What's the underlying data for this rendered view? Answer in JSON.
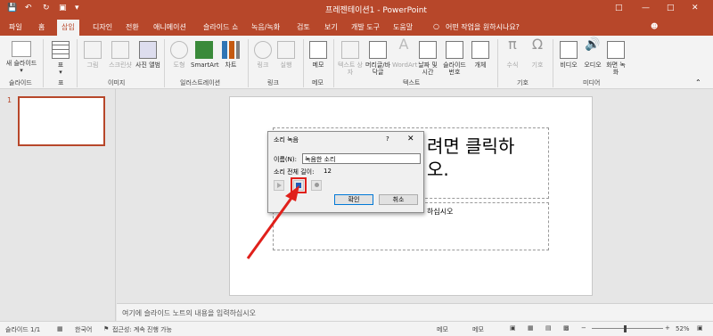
{
  "window": {
    "title": "프레젠테이션1 - PowerPoint",
    "file_tab": "파일",
    "tabs": [
      "홈",
      "삽입",
      "디자인",
      "전환",
      "애니메이션",
      "슬라이드 쇼",
      "녹음/녹화",
      "검토",
      "보기",
      "개발 도구",
      "도움말"
    ],
    "tell_me": "어떤 작업을 원하시나요?"
  },
  "ribbon": {
    "new_slide": "새 슬라이드",
    "table": "표",
    "picture": "그림",
    "screenshot": "스크린샷",
    "photo_album": "사진 앨범",
    "shapes": "도형",
    "smartart": "SmartArt",
    "chart": "차트",
    "link": "링크",
    "action": "실행",
    "comment": "메모",
    "textbox": "텍스트 상자",
    "header_footer": "머리글/바닥글",
    "wordart": "WordArt",
    "date_time": "날짜 및 시간",
    "slide_number": "슬라이드 번호",
    "object": "개체",
    "equation": "수식",
    "symbol": "기호",
    "video": "비디오",
    "audio": "오디오",
    "screen_recording": "화면 녹화",
    "groups": {
      "slides": "슬라이드",
      "tables": "표",
      "images": "이미지",
      "illustrations": "일러스트레이션",
      "links": "링크",
      "comments": "메모",
      "text": "텍스트",
      "symbols": "기호",
      "media": "미디어"
    }
  },
  "thumbs": {
    "slide_number": "1"
  },
  "slide": {
    "title_text_line1": "려면 클릭하",
    "title_text_line2": "오.",
    "subtitle_text": "하십시오"
  },
  "notes": {
    "placeholder": "여기에 슬라이드 노트의 내용을 입력하십시오"
  },
  "status": {
    "slide_info": "슬라이드 1/1",
    "language": "한국어",
    "accessibility": "접근성: 계속 진행 가능",
    "notes": "메모",
    "comments": "메모",
    "zoom": "52%"
  },
  "dialog": {
    "title": "소리 녹음",
    "help": "?",
    "name_label": "이름(N):",
    "name_value": "녹음한 소리",
    "length_label": "소리 전체 길이:",
    "length_value": "12",
    "ok": "확인",
    "cancel": "취소"
  },
  "colors": {
    "accent": "#b7472a",
    "highlight": "#e0201b"
  }
}
